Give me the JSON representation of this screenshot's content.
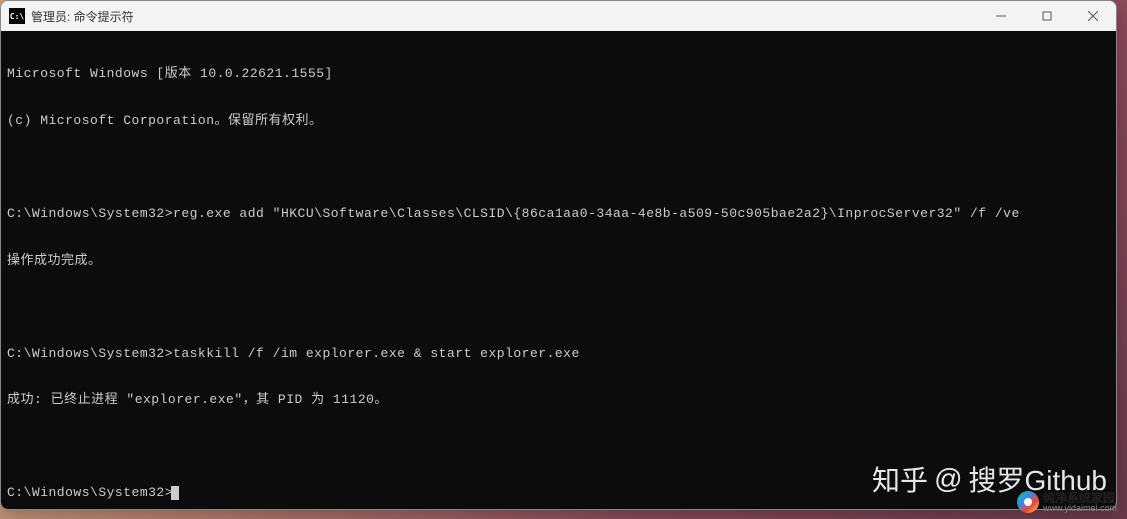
{
  "window": {
    "title": "管理员: 命令提示符",
    "icon_label": "C:\\"
  },
  "terminal": {
    "lines": [
      "Microsoft Windows [版本 10.0.22621.1555]",
      "(c) Microsoft Corporation。保留所有权利。",
      "",
      "C:\\Windows\\System32>reg.exe add \"HKCU\\Software\\Classes\\CLSID\\{86ca1aa0-34aa-4e8b-a509-50c905bae2a2}\\InprocServer32\" /f /ve",
      "操作成功完成。",
      "",
      "C:\\Windows\\System32>taskkill /f /im explorer.exe & start explorer.exe",
      "成功: 已终止进程 \"explorer.exe\"，其 PID 为 11120。",
      "",
      "C:\\Windows\\System32>"
    ]
  },
  "watermark": {
    "zhihu": "知乎",
    "at": "@",
    "author": "搜罗Github"
  },
  "site_badge": {
    "name": "纯净系统家园",
    "url": "www.yidaimei.com"
  }
}
